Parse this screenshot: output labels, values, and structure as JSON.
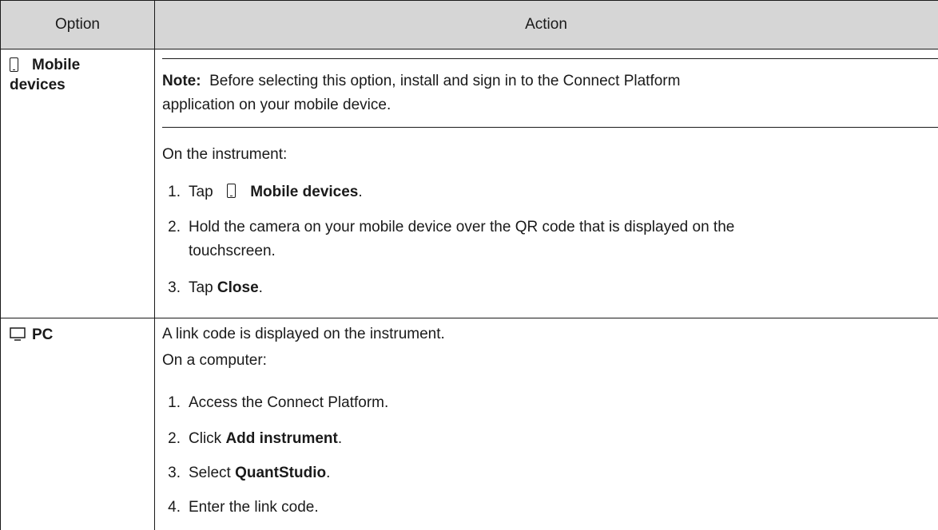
{
  "header": {
    "option": "Option",
    "action": "Action"
  },
  "rows": [
    {
      "option_label_line1": "Mobile",
      "option_label_line2": "devices",
      "option_icon": "mobile-phone-icon",
      "note_label": "Note:",
      "note_text_line1": "Before selecting this option, install and sign in to the Connect Platform",
      "note_text_line2": "application on your mobile device.",
      "intro": "On the instrument:",
      "steps": [
        {
          "num": "1.",
          "pre": "Tap",
          "icon": "mobile-phone-icon",
          "bold": "Mobile devices",
          "post": "."
        },
        {
          "num": "2.",
          "line1": "Hold the camera on your mobile device over the QR code that is displayed on the",
          "line2": "touchscreen."
        },
        {
          "num": "3.",
          "pre": "Tap ",
          "bold": "Close",
          "post": "."
        }
      ]
    },
    {
      "option_label": "PC",
      "option_icon": "monitor-icon",
      "line1": "A link code is displayed on the instrument.",
      "intro": "On a computer:",
      "steps": [
        {
          "num": "1.",
          "text": "Access the Connect Platform."
        },
        {
          "num": "2.",
          "pre": "Click ",
          "bold": "Add instrument",
          "post": "."
        },
        {
          "num": "3.",
          "pre": "Select ",
          "bold": "QuantStudio",
          "post": "."
        },
        {
          "num": "4.",
          "text": "Enter the link code."
        }
      ]
    }
  ]
}
